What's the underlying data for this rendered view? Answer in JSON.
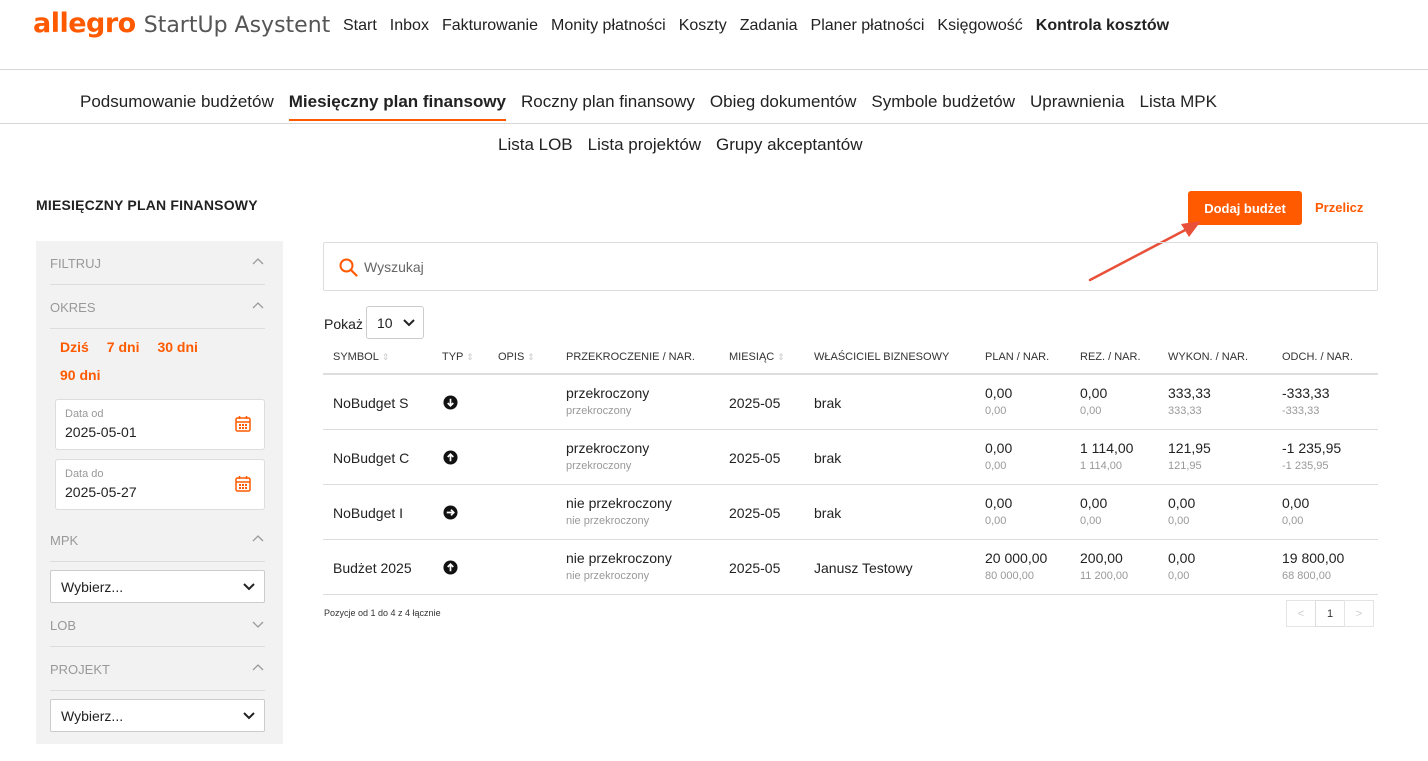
{
  "brand": {
    "logo": "allegro",
    "name": "StartUp Asystent"
  },
  "topnav": [
    "Start",
    "Inbox",
    "Fakturowanie",
    "Monity płatności",
    "Koszty",
    "Zadania",
    "Planer płatności",
    "Księgowość",
    "Kontrola kosztów"
  ],
  "subnav": {
    "row1": [
      "Podsumowanie budżetów",
      "Miesięczny plan finansowy",
      "Roczny plan finansowy",
      "Obieg dokumentów",
      "Symbole budżetów",
      "Uprawnienia",
      "Lista MPK"
    ],
    "row2": [
      "Lista LOB",
      "Lista projektów",
      "Grupy akceptantów"
    ]
  },
  "page_title": "MIESIĘCZNY PLAN FINANSOWY",
  "actions": {
    "add": "Dodaj budżet",
    "recalc": "Przelicz"
  },
  "sidebar": {
    "filter": "FILTRUJ",
    "period": "OKRES",
    "period_links": [
      "Dziś",
      "7 dni",
      "30 dni",
      "90 dni"
    ],
    "date_from_label": "Data od",
    "date_from": "2025-05-01",
    "date_to_label": "Data do",
    "date_to": "2025-05-27",
    "mpk": "MPK",
    "mpk_select": "Wybierz...",
    "lob": "LOB",
    "project": "PROJEKT",
    "project_select": "Wybierz..."
  },
  "search": {
    "placeholder": "Wyszukaj"
  },
  "pagesize": {
    "label": "Pokaż",
    "value": "10"
  },
  "table": {
    "headers": [
      "SYMBOL",
      "TYP",
      "OPIS",
      "PRZEKROCZENIE / NAR.",
      "MIESIĄC",
      "WŁAŚCICIEL BIZNESOWY",
      "PLAN / NAR.",
      "REZ. / NAR.",
      "WYKON. / NAR.",
      "ODCH. / NAR."
    ],
    "rows": [
      {
        "symbol": "NoBudget S",
        "typ": "down",
        "exceed": "przekroczony",
        "exceed_sub": "przekroczony",
        "month": "2025-05",
        "owner": "brak",
        "plan": "0,00",
        "plan_sub": "0,00",
        "rez": "0,00",
        "rez_sub": "0,00",
        "wyk": "333,33",
        "wyk_sub": "333,33",
        "odch": "-333,33",
        "odch_sub": "-333,33"
      },
      {
        "symbol": "NoBudget C",
        "typ": "up",
        "exceed": "przekroczony",
        "exceed_sub": "przekroczony",
        "month": "2025-05",
        "owner": "brak",
        "plan": "0,00",
        "plan_sub": "0,00",
        "rez": "1 114,00",
        "rez_sub": "1 114,00",
        "wyk": "121,95",
        "wyk_sub": "121,95",
        "odch": "-1 235,95",
        "odch_sub": "-1 235,95"
      },
      {
        "symbol": "NoBudget I",
        "typ": "right",
        "exceed": "nie przekroczony",
        "exceed_sub": "nie przekroczony",
        "month": "2025-05",
        "owner": "brak",
        "plan": "0,00",
        "plan_sub": "0,00",
        "rez": "0,00",
        "rez_sub": "0,00",
        "wyk": "0,00",
        "wyk_sub": "0,00",
        "odch": "0,00",
        "odch_sub": "0,00"
      },
      {
        "symbol": "Budżet 2025",
        "typ": "up",
        "exceed": "nie przekroczony",
        "exceed_sub": "nie przekroczony",
        "month": "2025-05",
        "owner": "Janusz Testowy",
        "plan": "20 000,00",
        "plan_sub": "80 000,00",
        "rez": "200,00",
        "rez_sub": "11 200,00",
        "wyk": "0,00",
        "wyk_sub": "0,00",
        "odch": "19 800,00",
        "odch_sub": "68 800,00"
      }
    ]
  },
  "footer": {
    "info": "Pozycje od 1 do 4 z 4 łącznie",
    "page": "1",
    "prev": "<",
    "next": ">"
  },
  "colors": {
    "accent": "#ff5a00",
    "arrow": "#e8503a"
  }
}
